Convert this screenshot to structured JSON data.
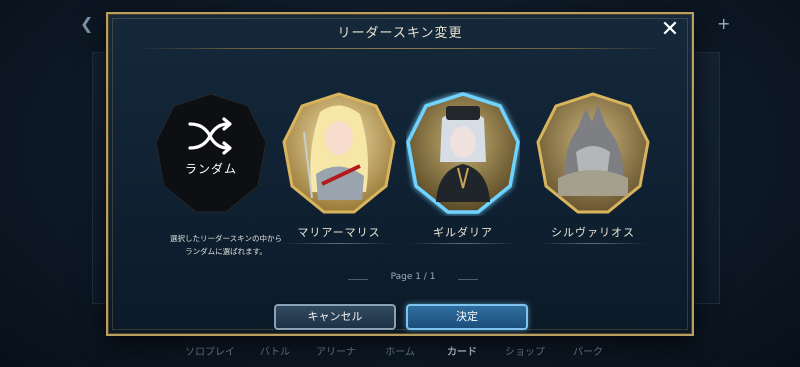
{
  "background": {
    "nav_items": [
      "ソロプレイ",
      "バトル",
      "アリーナ",
      "ホーム",
      "カード",
      "ショップ",
      "パーク"
    ],
    "active_nav": "カード"
  },
  "dialog": {
    "title": "リーダースキン変更",
    "close_icon": "close-icon",
    "random": {
      "label": "ランダム",
      "icon": "shuffle-icon",
      "description_line1": "選択したリーダースキンの中から",
      "description_line2": "ランダムに選ばれます。"
    },
    "skins": [
      {
        "name": "マリアーマリス",
        "selected": false
      },
      {
        "name": "ギルダリア",
        "selected": true
      },
      {
        "name": "シルヴァリオス",
        "selected": false
      }
    ],
    "pager": {
      "label": "Page",
      "current": "1",
      "separator": "/",
      "total": "1",
      "text": "Page   1 / 1"
    },
    "cancel_label": "キャンセル",
    "confirm_label": "決定"
  },
  "colors": {
    "gold_frame": "#b9a060",
    "selected_glow": "#6fd3ff",
    "confirm_button": "#2f6fa0"
  }
}
